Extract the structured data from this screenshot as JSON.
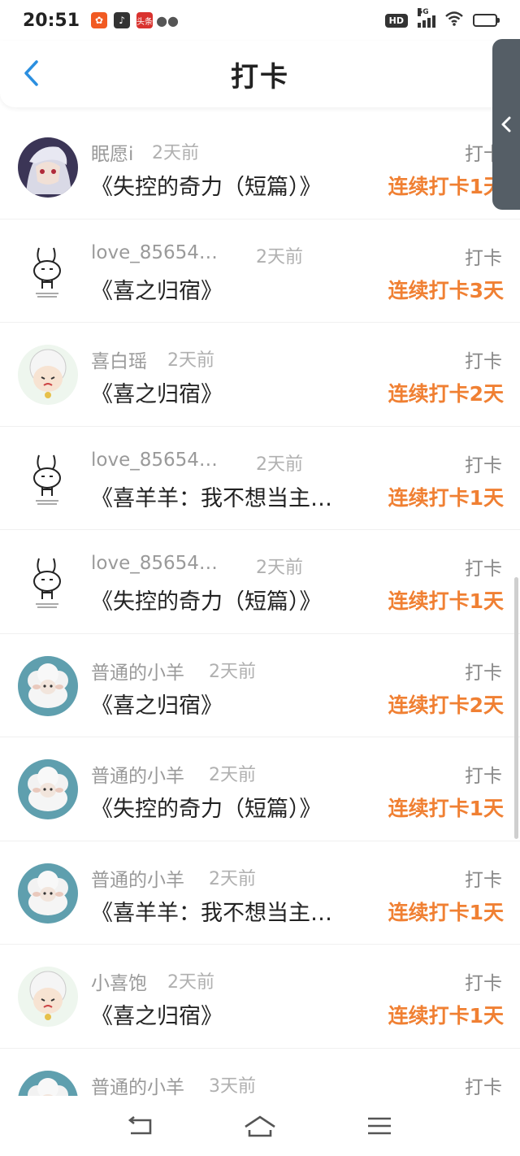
{
  "status_bar": {
    "time": "20:51",
    "app_badge_red": "头条",
    "hd": "HD",
    "network": "5G",
    "battery_level": 0.3
  },
  "header": {
    "title": "打卡"
  },
  "colors": {
    "accent": "#f08033",
    "back_arrow": "#2b8fe0",
    "muted": "#9a9a9a"
  },
  "rows": [
    {
      "user": "眠愿i",
      "time": "2天前",
      "tag": "打卡",
      "book": "《失控的奇力（短篇）》",
      "streak": "连续打卡1天",
      "avatar": "anime-avatar"
    },
    {
      "user": "love_85654…",
      "time": "2天前",
      "tag": "打卡",
      "book": "《喜之归宿》",
      "streak": "连续打卡3天",
      "avatar": "rabbit-avatar"
    },
    {
      "user": "喜白瑶",
      "time": "2天前",
      "tag": "打卡",
      "book": "《喜之归宿》",
      "streak": "连续打卡2天",
      "avatar": "sheep-cartoon-avatar"
    },
    {
      "user": "love_85654…",
      "time": "2天前",
      "tag": "打卡",
      "book": "《喜羊羊：我不想当主…",
      "streak": "连续打卡1天",
      "avatar": "rabbit-avatar"
    },
    {
      "user": "love_85654…",
      "time": "2天前",
      "tag": "打卡",
      "book": "《失控的奇力（短篇）》",
      "streak": "连续打卡1天",
      "avatar": "rabbit-avatar"
    },
    {
      "user": "普通的小羊",
      "time": "2天前",
      "tag": "打卡",
      "book": "《喜之归宿》",
      "streak": "连续打卡2天",
      "avatar": "sheep-avatar"
    },
    {
      "user": "普通的小羊",
      "time": "2天前",
      "tag": "打卡",
      "book": "《失控的奇力（短篇）》",
      "streak": "连续打卡1天",
      "avatar": "sheep-avatar"
    },
    {
      "user": "普通的小羊",
      "time": "2天前",
      "tag": "打卡",
      "book": "《喜羊羊：我不想当主…",
      "streak": "连续打卡1天",
      "avatar": "sheep-avatar"
    },
    {
      "user": "小喜饱",
      "time": "2天前",
      "tag": "打卡",
      "book": "《喜之归宿》",
      "streak": "连续打卡1天",
      "avatar": "sheep-cartoon-avatar"
    },
    {
      "user": "普通的小羊",
      "time": "3天前",
      "tag": "打卡",
      "book": "",
      "streak": "",
      "avatar": "sheep-avatar"
    }
  ]
}
